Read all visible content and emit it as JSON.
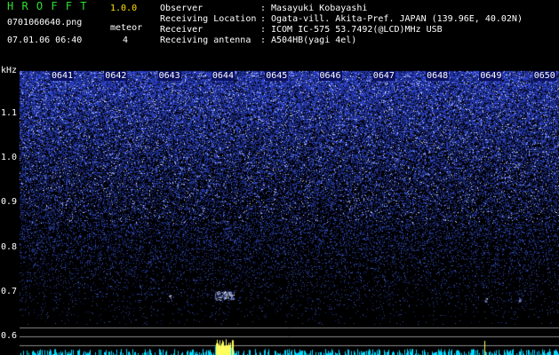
{
  "header": {
    "app_title": "H R O F F T",
    "version": "1.0.0",
    "filename": "0701060640.png",
    "datetime": "07.01.06 06:40",
    "meteor_label": "meteor",
    "meteor_count": "4"
  },
  "info": {
    "rows": [
      {
        "label": "Observer",
        "sep": ":",
        "value": "Masayuki Kobayashi"
      },
      {
        "label": "Receiving Location",
        "sep": ":",
        "value": "Ogata-vill. Akita-Pref. JAPAN (139.96E, 40.02N)"
      },
      {
        "label": "Receiver",
        "sep": ":",
        "value": "ICOM IC-575 53.7492(@LCD)MHz USB"
      },
      {
        "label": "Receiving antenna",
        "sep": ":",
        "value": "A504HB(yagi 4el)"
      }
    ]
  },
  "chart_data": {
    "type": "heatmap",
    "ylabel": "kHz",
    "y_ticks": [
      "1.1",
      "1.0",
      "0.9",
      "0.8",
      "0.7",
      "0.6"
    ],
    "x_ticks": [
      "0641",
      "0642",
      "0643",
      "0644",
      "0645",
      "0646",
      "0647",
      "0648",
      "0649",
      "0650"
    ],
    "ylim": [
      0.58,
      1.2
    ]
  },
  "colors": {
    "header_green": "#2ee02e",
    "highlight_yellow": "#ffe000",
    "noise_blue": "#3a4cff",
    "meteor_bright": "#ffffff",
    "power_cyan": "#00e0ff"
  }
}
